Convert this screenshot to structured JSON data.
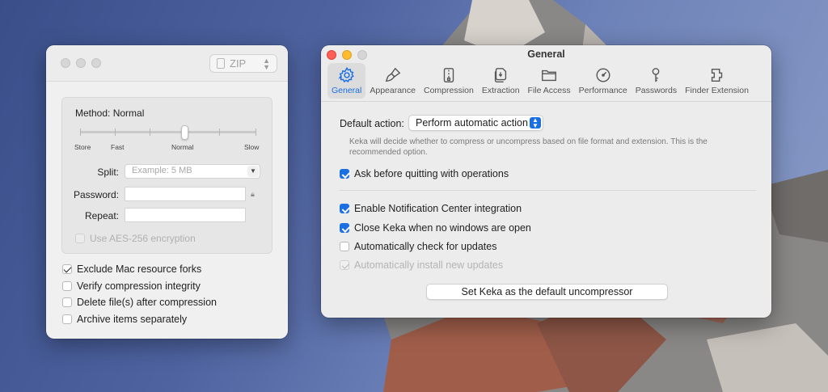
{
  "keka_window": {
    "format": "ZIP",
    "method_label": "Method: Normal",
    "slider_labels": [
      "Store",
      "Fast",
      "Normal",
      "Slow"
    ],
    "compression_level_index": 4,
    "compression_level_max": 6,
    "split_label": "Split:",
    "split_placeholder": "Example: 5 MB",
    "password_label": "Password:",
    "repeat_label": "Repeat:",
    "aes_label": "Use AES-256 encryption",
    "options": [
      {
        "label": "Exclude Mac resource forks",
        "checked": true
      },
      {
        "label": "Verify compression integrity",
        "checked": false
      },
      {
        "label": "Delete file(s) after compression",
        "checked": false
      },
      {
        "label": "Archive items separately",
        "checked": false
      }
    ]
  },
  "preferences": {
    "title": "General",
    "tabs": [
      {
        "label": "General",
        "icon": "gear-icon",
        "active": true
      },
      {
        "label": "Appearance",
        "icon": "paintbrush-icon"
      },
      {
        "label": "Compression",
        "icon": "compression-icon"
      },
      {
        "label": "Extraction",
        "icon": "extraction-icon"
      },
      {
        "label": "File Access",
        "icon": "folder-icon"
      },
      {
        "label": "Performance",
        "icon": "gauge-icon"
      },
      {
        "label": "Passwords",
        "icon": "key-icon"
      },
      {
        "label": "Finder Extension",
        "icon": "finder-extension-icon"
      }
    ],
    "default_action_label": "Default action:",
    "default_action_value": "Perform automatic action",
    "hint": "Keka will decide whether to compress or uncompress based on file format and extension. This is the recommended option.",
    "ask_quit": {
      "label": "Ask before quitting with operations",
      "checked": true
    },
    "notification": {
      "label": "Enable Notification Center integration",
      "checked": true
    },
    "close_keka": {
      "label": "Close Keka when no windows are open",
      "checked": true
    },
    "auto_check": {
      "label": "Automatically check for updates",
      "checked": false
    },
    "auto_install": {
      "label": "Automatically install new updates",
      "checked": true,
      "disabled": true
    },
    "default_button": "Set Keka as the default uncompressor"
  },
  "colors": {
    "accent": "#1a6fe3",
    "close": "#fe5f57",
    "minimize": "#febc2e"
  }
}
